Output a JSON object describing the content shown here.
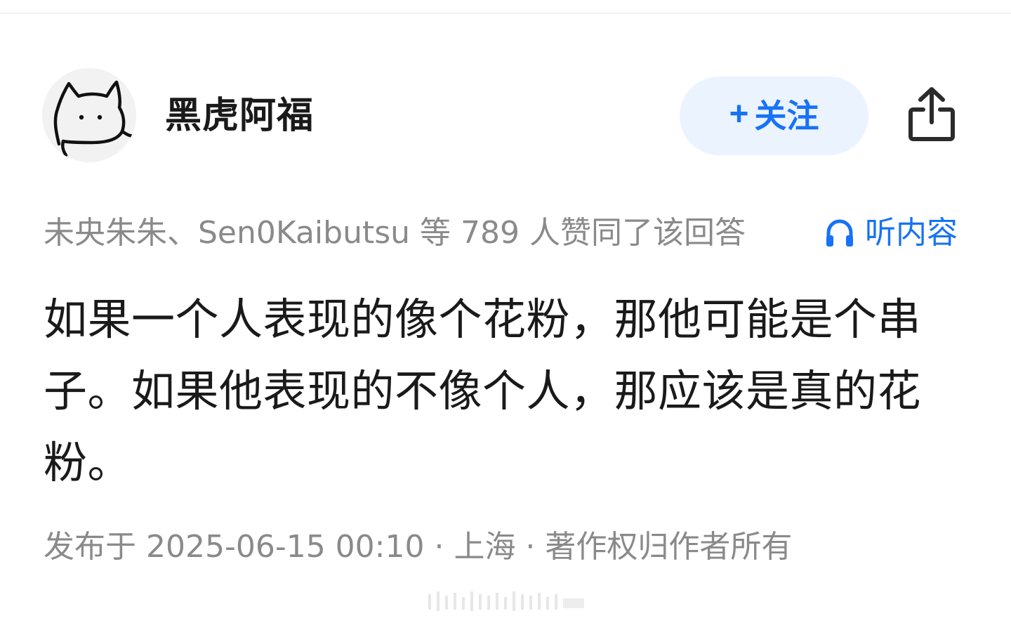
{
  "author": {
    "name": "黑虎阿福",
    "avatar_icon": "cat-doodle-avatar"
  },
  "actions": {
    "follow_plus": "+",
    "follow_label": "关注",
    "share_icon": "share-icon",
    "listen_icon": "headphones-icon",
    "listen_label": "听内容"
  },
  "likes": {
    "text": "未央朱朱、Sen0Kaibutsu 等 789 人赞同了该回答"
  },
  "answer": {
    "text": "如果一个人表现的像个花粉，那他可能是个串子。如果他表现的不像个人，那应该是真的花粉。"
  },
  "meta": {
    "text": "发布于 2025-06-15 00:10 · 上海 · 著作权归作者所有"
  },
  "colors": {
    "accent": "#1772f6",
    "follow_bg": "#ebf3fe",
    "muted_text": "#8a8a8a",
    "primary_text": "#1a1a1a"
  }
}
